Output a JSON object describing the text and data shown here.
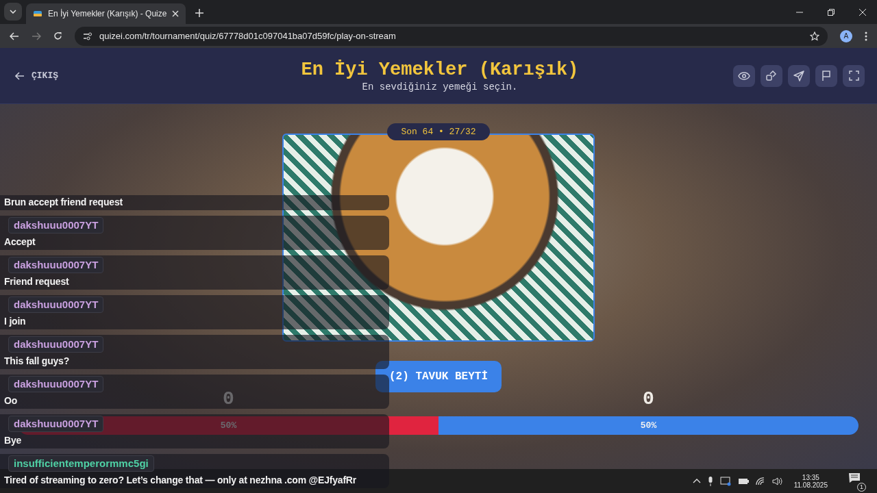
{
  "browser": {
    "tab_title": "En İyi Yemekler (Karışık) - Quize",
    "url": "quizei.com/tr/tournament/quiz/67778d01c097041ba07d59fc/play-on-stream",
    "profile_initial": "A"
  },
  "header": {
    "back_label": "ÇIKIŞ",
    "title": "En İyi Yemekler (Karışık)",
    "subtitle": "En sevdiğiniz yemeği seçin."
  },
  "round": "Son 64 • 27/32",
  "option": {
    "label": "(2) TAVUK BEYTİ"
  },
  "scores": [
    "0",
    "0"
  ],
  "vote_bar": [
    {
      "label": "50%",
      "level": 0.5,
      "color": "#e0243f"
    },
    {
      "label": "50%",
      "level": 0.5,
      "color": "#3b82e8"
    }
  ],
  "chat": [
    {
      "text": "Brun accept friend request"
    },
    {
      "user": "dakshuuu0007YT",
      "color": "#c9a0e0",
      "text": "Accept"
    },
    {
      "user": "dakshuuu0007YT",
      "color": "#c9a0e0",
      "text": "Friend request"
    },
    {
      "user": "dakshuuu0007YT",
      "color": "#c9a0e0",
      "text": "I join"
    },
    {
      "user": "dakshuuu0007YT",
      "color": "#c9a0e0",
      "text": "This fall guys?"
    },
    {
      "user": "dakshuuu0007YT",
      "color": "#c9a0e0",
      "text": "Oo"
    },
    {
      "user": "dakshuuu0007YT",
      "color": "#c9a0e0",
      "text": "Bye"
    },
    {
      "user": "insufficientemperormmc5gi",
      "color": "#4fd1a5",
      "text": "Tired of streaming to zero? Let’s change that — only at nezhna .com @EJfyafRr"
    }
  ],
  "taskbar": {
    "time": "13:35",
    "date": "11.08.2025",
    "notifications": "1"
  }
}
